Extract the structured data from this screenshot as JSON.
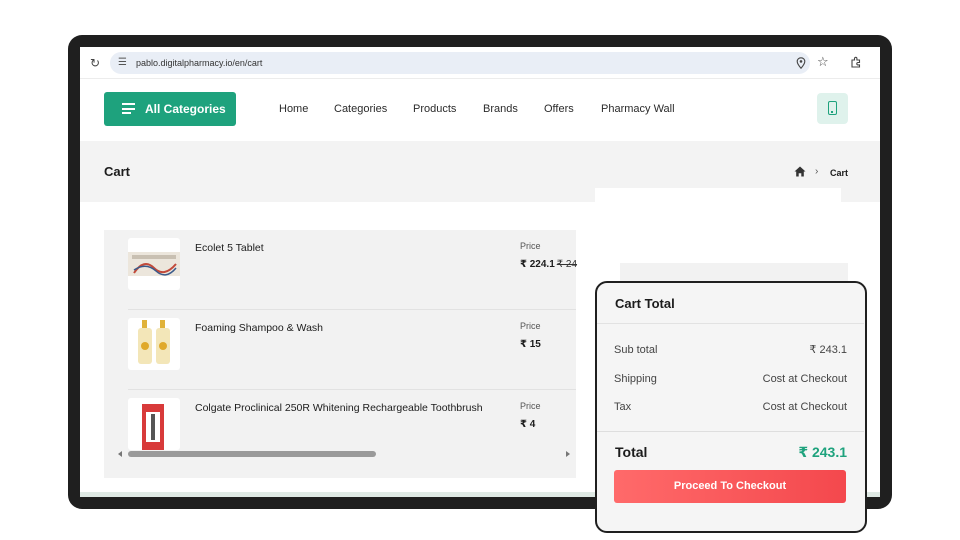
{
  "browser": {
    "url": "pablo.digitalpharmacy.io/en/cart",
    "icons": [
      "reload-icon",
      "site-settings-icon",
      "location-icon",
      "star-icon",
      "extensions-icon"
    ]
  },
  "nav": {
    "all_categories": "All Categories",
    "links": [
      "Home",
      "Categories",
      "Products",
      "Brands",
      "Offers",
      "Pharmacy Wall"
    ]
  },
  "page": {
    "title": "Cart",
    "breadcrumb_current": "Cart"
  },
  "cart": {
    "items": [
      {
        "name": "Ecolet 5 Tablet",
        "price_label": "Price",
        "price": "₹ 224.1",
        "old_price": "₹ 24"
      },
      {
        "name": "Foaming Shampoo & Wash",
        "price_label": "Price",
        "price": "₹ 15",
        "old_price": ""
      },
      {
        "name": "Colgate Proclinical 250R Whitening Rechargeable Toothbrush",
        "price_label": "Price",
        "price": "₹ 4",
        "old_price": ""
      }
    ]
  },
  "summary": {
    "title": "Cart Total",
    "rows": [
      {
        "label": "Sub total",
        "value": "₹ 243.1"
      },
      {
        "label": "Shipping",
        "value": "Cost at Checkout"
      },
      {
        "label": "Tax",
        "value": "Cost at Checkout"
      }
    ],
    "total_label": "Total",
    "total_value": "₹ 243.1",
    "checkout_label": "Proceed To Checkout"
  },
  "colors": {
    "brand_green": "#1ea27d",
    "checkout_red": "#f4484d",
    "frame": "#1f1f1f"
  }
}
